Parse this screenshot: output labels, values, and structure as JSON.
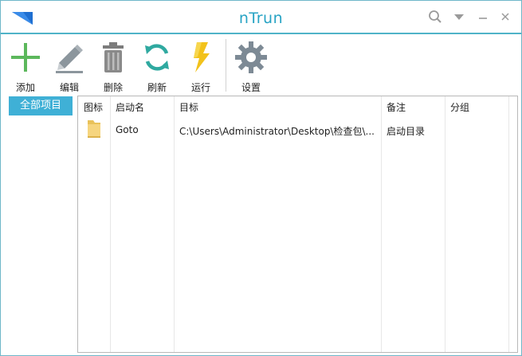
{
  "window": {
    "title": "nTrun",
    "accent_color": "#27a3c4"
  },
  "title_controls": [
    {
      "name": "search-button",
      "icon": "search-icon"
    },
    {
      "name": "dropdown-button",
      "icon": "chevron-down-icon"
    },
    {
      "name": "minimize-button",
      "icon": "minimize-icon"
    },
    {
      "name": "close-button",
      "icon": "close-icon"
    }
  ],
  "toolbar": {
    "add_label": "添加",
    "edit_label": "编辑",
    "delete_label": "删除",
    "refresh_label": "刷新",
    "run_label": "运行",
    "settings_label": "设置"
  },
  "sidebar": {
    "items": [
      {
        "label": "全部项目",
        "selected": true
      }
    ]
  },
  "table": {
    "headers": [
      "图标",
      "启动名",
      "目标",
      "备注",
      "分组"
    ],
    "rows": [
      {
        "icon": "folder-icon",
        "name": "Goto",
        "target": "C:\\Users\\Administrator\\Desktop\\检查包\\...",
        "note": "启动目录",
        "group": ""
      }
    ]
  }
}
